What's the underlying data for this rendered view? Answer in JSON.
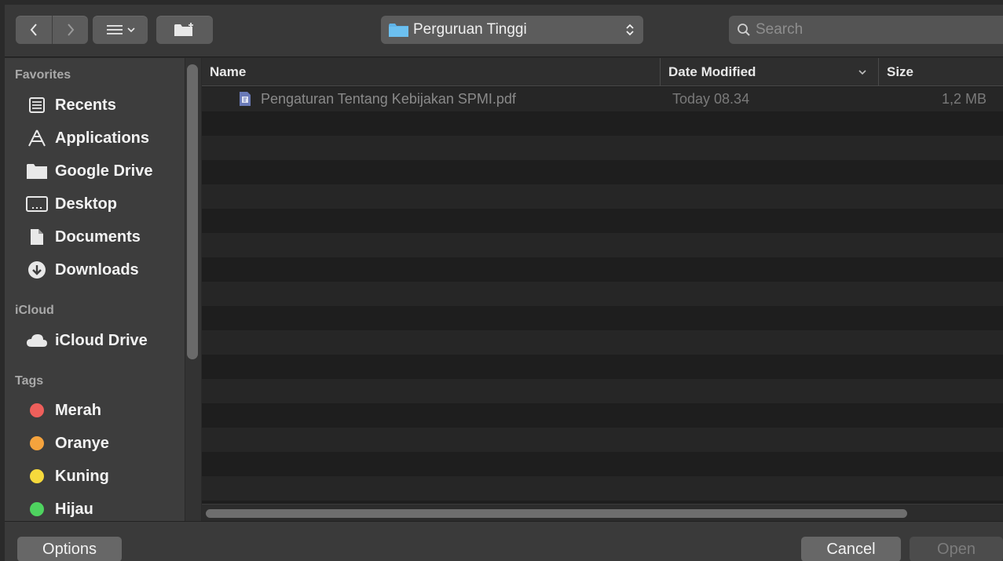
{
  "toolbar": {
    "back_icon": "chevron-left-icon",
    "forward_icon": "chevron-right-icon",
    "view_icon": "list-view-icon",
    "new_folder_icon": "new-folder-icon",
    "location": "Perguruan Tinggi",
    "search_placeholder": "Search"
  },
  "sidebar": {
    "favorites_title": "Favorites",
    "favorites": [
      {
        "label": "Recents",
        "icon": "recents-icon"
      },
      {
        "label": "Applications",
        "icon": "applications-icon"
      },
      {
        "label": "Google Drive",
        "icon": "folder-icon"
      },
      {
        "label": "Desktop",
        "icon": "desktop-icon"
      },
      {
        "label": "Documents",
        "icon": "documents-icon"
      },
      {
        "label": "Downloads",
        "icon": "downloads-icon"
      }
    ],
    "icloud_title": "iCloud",
    "icloud": [
      {
        "label": "iCloud Drive",
        "icon": "cloud-icon"
      }
    ],
    "tags_title": "Tags",
    "tags": [
      {
        "label": "Merah",
        "color": "#ee5f5b"
      },
      {
        "label": "Oranye",
        "color": "#f5a33d"
      },
      {
        "label": "Kuning",
        "color": "#f6d93c"
      },
      {
        "label": "Hijau",
        "color": "#4ed35f"
      }
    ]
  },
  "filelist": {
    "columns": {
      "name": "Name",
      "date": "Date Modified",
      "size": "Size"
    },
    "files": [
      {
        "name": "Pengaturan Tentang Kebijakan SPMI.pdf",
        "date": "Today 08.34",
        "size": "1,2 MB",
        "icon": "pdf-file-icon"
      }
    ]
  },
  "buttons": {
    "options": "Options",
    "cancel": "Cancel",
    "open": "Open"
  },
  "colors": {
    "folder_blue": "#5fb3e8"
  }
}
